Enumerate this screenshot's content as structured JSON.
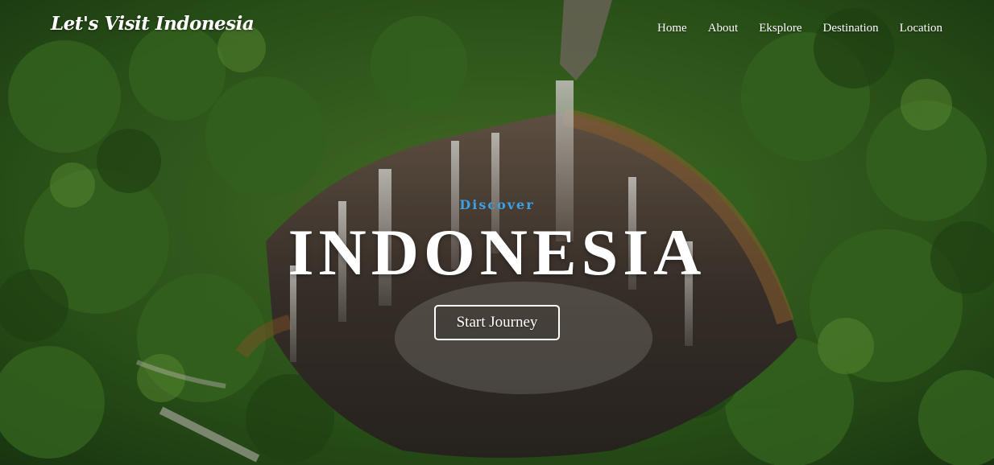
{
  "header": {
    "brand": "Let's Visit Indonesia",
    "nav": [
      "Home",
      "About",
      "Eksplore",
      "Destination",
      "Location"
    ]
  },
  "hero": {
    "eyebrow": "Discover",
    "title": "INDONESIA",
    "cta_label": "Start Journey",
    "background": "aerial-waterfall-jungle-photo"
  },
  "colors": {
    "eyebrow": "#3f9fe3",
    "text": "#ffffff",
    "forest": "#2f5a1c"
  }
}
